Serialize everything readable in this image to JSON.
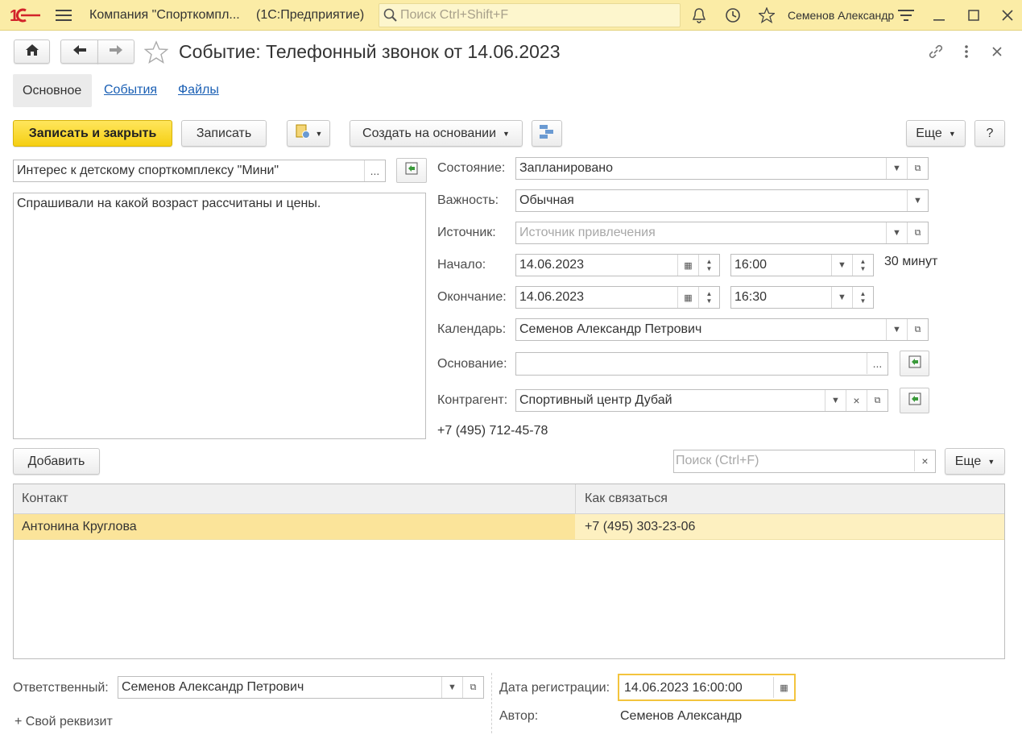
{
  "titlebar": {
    "app_title": "Компания \"Спорткомпл...",
    "platform": "(1С:Предприятие)",
    "search_placeholder": "Поиск Ctrl+Shift+F",
    "user": "Семенов Александр"
  },
  "form": {
    "title": "Событие: Телефонный звонок от 14.06.2023",
    "tabs": [
      "Основное",
      "События",
      "Файлы"
    ]
  },
  "toolbar": {
    "save_close": "Записать и закрыть",
    "save": "Записать",
    "create_based": "Создать на основании",
    "more": "Еще",
    "help": "?"
  },
  "subject": "Интерес к детскому спорткомплексу \"Мини\"",
  "description": "Спрашивали на какой возраст рассчитаны и цены.",
  "fields": {
    "state_label": "Состояние:",
    "state": "Запланировано",
    "importance_label": "Важность:",
    "importance": "Обычная",
    "source_label": "Источник:",
    "source_placeholder": "Источник привлечения",
    "start_label": "Начало:",
    "start_date": "14.06.2023",
    "start_time": "16:00",
    "duration": "30 минут",
    "end_label": "Окончание:",
    "end_date": "14.06.2023",
    "end_time": "16:30",
    "calendar_label": "Календарь:",
    "calendar": "Семенов Александр Петрович",
    "basis_label": "Основание:",
    "basis": "",
    "counterparty_label": "Контрагент:",
    "counterparty": "Спортивный центр Дубай",
    "phone": "+7 (495) 712-45-78"
  },
  "contacts": {
    "add": "Добавить",
    "search_placeholder": "Поиск (Ctrl+F)",
    "more": "Еще",
    "headers": [
      "Контакт",
      "Как связаться"
    ],
    "rows": [
      [
        "Антонина Круглова",
        "+7 (495) 303-23-06"
      ]
    ]
  },
  "footer": {
    "responsible_label": "Ответственный:",
    "responsible": "Семенов Александр Петрович",
    "reg_date_label": "Дата регистрации:",
    "reg_date": "14.06.2023 16:00:00",
    "author_label": "Автор:",
    "author": "Семенов Александр",
    "custom_attr": "+ Свой реквизит"
  },
  "colors": {
    "accent": "#f5cf13",
    "titlebar": "#fbeca6",
    "selected_row": "#fbe49a",
    "link": "#1a5fb4"
  }
}
